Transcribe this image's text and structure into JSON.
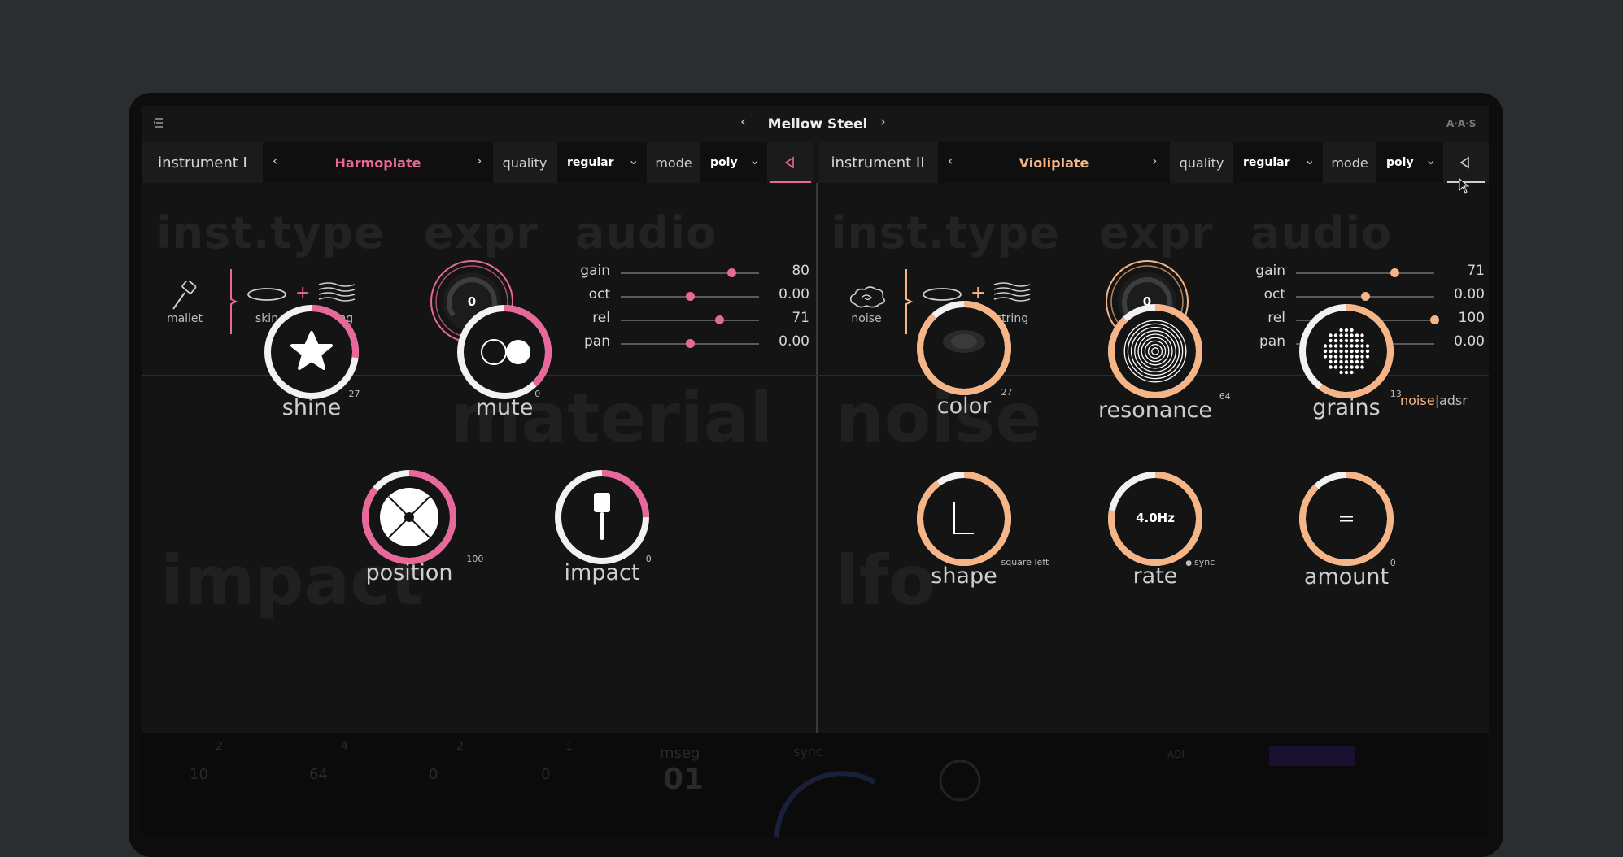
{
  "window": {
    "preset_name": "Mellow Steel",
    "brand": "A·A·S"
  },
  "instrument1": {
    "name": "instrument I",
    "preset": "Harmoplate",
    "quality_label": "quality",
    "quality_value": "regular",
    "mode_label": "mode",
    "mode_value": "poly",
    "sections": {
      "type": "inst.type",
      "expr": "expr",
      "audio": "audio",
      "material": "material",
      "impact": "impact"
    },
    "exciter": "mallet",
    "resonator_a": "skin",
    "resonator_b": "string",
    "expr_value": "0",
    "sliders": [
      {
        "label": "gain",
        "value": "80",
        "level": 0.8
      },
      {
        "label": "oct",
        "value": "0.00",
        "level": 0.5
      },
      {
        "label": "rel",
        "value": "71",
        "level": 0.71
      },
      {
        "label": "pan",
        "value": "0.00",
        "level": 0.5
      }
    ],
    "knobs": [
      {
        "label": "shine",
        "value": "27",
        "level": 0.27
      },
      {
        "label": "mute",
        "value": "0",
        "level": 0.38
      },
      {
        "label": "position",
        "value": "100",
        "level": 0.86
      },
      {
        "label": "impact",
        "value": "0",
        "level": 0.25
      }
    ],
    "accent": "#e8689a"
  },
  "instrument2": {
    "name": "instrument II",
    "preset": "Violiplate",
    "quality_label": "quality",
    "quality_value": "regular",
    "mode_label": "mode",
    "mode_value": "poly",
    "sections": {
      "type": "inst.type",
      "expr": "expr",
      "audio": "audio",
      "noise": "noise",
      "lfo": "lfo"
    },
    "exciter": "noise",
    "resonator_a": "skin",
    "resonator_b": "string",
    "expr_value": "0",
    "tabs": {
      "noise": "noise",
      "adsr": "adsr"
    },
    "sliders": [
      {
        "label": "gain",
        "value": "71",
        "level": 0.71
      },
      {
        "label": "oct",
        "value": "0.00",
        "level": 0.5
      },
      {
        "label": "rel",
        "value": "100",
        "level": 1.0
      },
      {
        "label": "pan",
        "value": "0.00",
        "level": 0.5
      }
    ],
    "knobs": [
      {
        "label": "color",
        "value": "27",
        "level": 0.88
      },
      {
        "label": "resonance",
        "value": "64",
        "level": 0.88
      },
      {
        "label": "grains",
        "value": "13",
        "level": 0.6
      },
      {
        "label": "shape",
        "value": "square left",
        "level": 0.9
      },
      {
        "label": "rate",
        "value": "sync",
        "level": 0.78,
        "display": "4.0Hz"
      },
      {
        "label": "amount",
        "value": "0",
        "level": 0.88
      }
    ],
    "accent": "#f5b586"
  },
  "colors": {
    "bg": "#2b2e31",
    "panel": "#141415",
    "pink": "#e8689a",
    "peach": "#f5b586"
  }
}
